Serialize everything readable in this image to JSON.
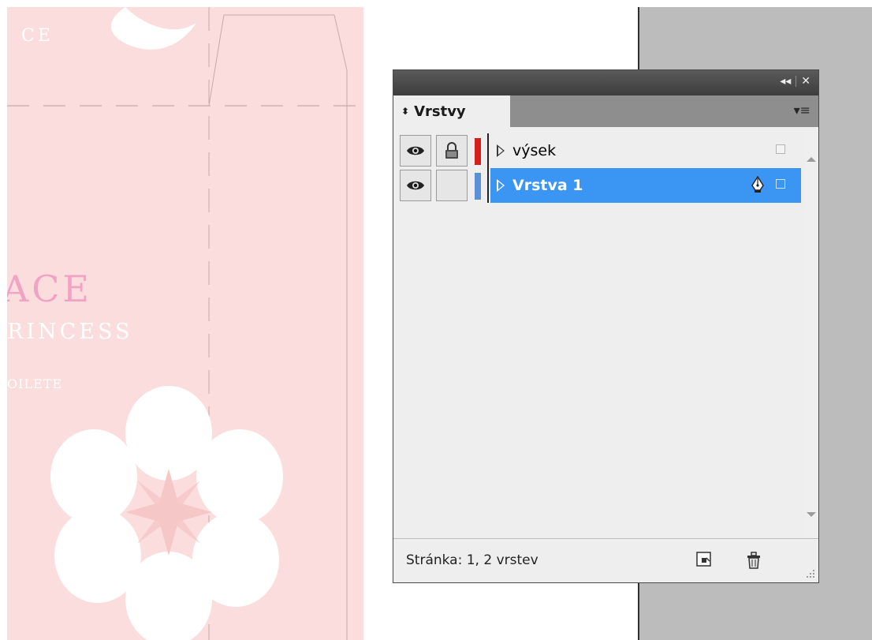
{
  "canvas": {
    "brand_top": "CE",
    "brand_name": "ACE",
    "brand_sub": "RINCESS",
    "brand_type": "OILETE"
  },
  "panel": {
    "tab_label": "Vrstvy",
    "layers": [
      {
        "name": "výsek",
        "color": "#d4201d",
        "visible": true,
        "locked": true,
        "selected": false
      },
      {
        "name": "Vrstva 1",
        "color": "#5b8fd6",
        "visible": true,
        "locked": false,
        "selected": true
      }
    ],
    "footer_status": "Stránka: 1, 2 vrstev"
  },
  "icons": {
    "collapse": "double-left-arrow-icon",
    "close": "close-icon",
    "menu": "panel-menu-icon",
    "visibility": "eye-icon",
    "lock": "lock-icon",
    "pen": "pen-icon",
    "new_layer": "new-layer-icon",
    "delete": "trash-icon",
    "resize": "resize-grip-icon"
  },
  "colors": {
    "canvas_bg": "#fbdddd",
    "selection": "#3b95f2",
    "panel_bg": "#eeeeee"
  }
}
